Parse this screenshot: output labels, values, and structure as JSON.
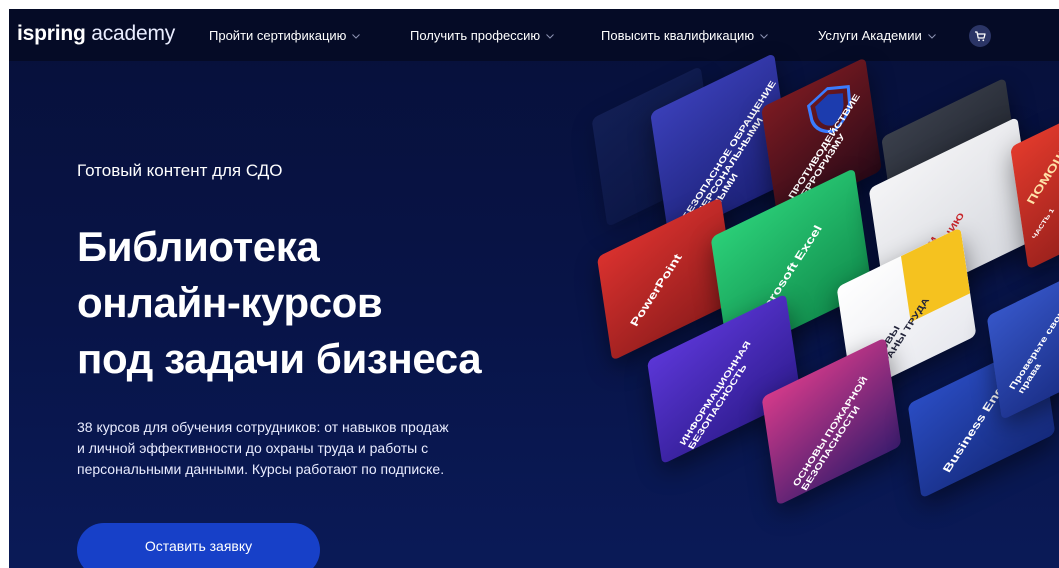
{
  "header": {
    "logo_bold": "ispring",
    "logo_light": "academy",
    "nav": [
      "Пройти сертификацию",
      "Получить профессию",
      "Повысить квалификацию",
      "Услуги Академии"
    ],
    "cart_icon": "cart-icon"
  },
  "hero": {
    "kicker": "Готовый контент для СДО",
    "title_lines": [
      "Библиотека",
      "онлайн-курсов",
      "под задачи бизнеса"
    ],
    "description_lines": [
      "38 курсов для обучения сотрудников: от навыков продаж",
      "и личной эффективности до охраны труда и работы с",
      "персональными данными. Курсы работают по подписке."
    ],
    "cta": "Оставить заявку"
  },
  "cards": [
    "БЕЗОПАСНОЕ ОБРАЩЕНИЕ С ПЕРСОНАЛЬНЫМИ ДАННЫМИ",
    "ПРОТИВОДЕЙСТВИЕ ТЕРРОРИЗМУ",
    "PowerPoint",
    "Microsoft Excel",
    "ГОТОВИМ ПРЕЗЕНТАЦИЮ",
    "ОСНОВЫ ОХРАНЫ ТРУДА",
    "ИНФОРМАЦИОННАЯ БЕЗОПАСНОСТЬ",
    "ОСНОВЫ ПОЖАРНОЙ БЕЗОПАСНОСТИ",
    "Business English",
    "Проверьте свои права",
    "ПОМОЩЬ",
    "ЧАСТЬ 1"
  ],
  "colors": {
    "background": "#081448",
    "cta": "#1740c8",
    "accent_green": "#1fb86a",
    "accent_red": "#c8262b"
  }
}
